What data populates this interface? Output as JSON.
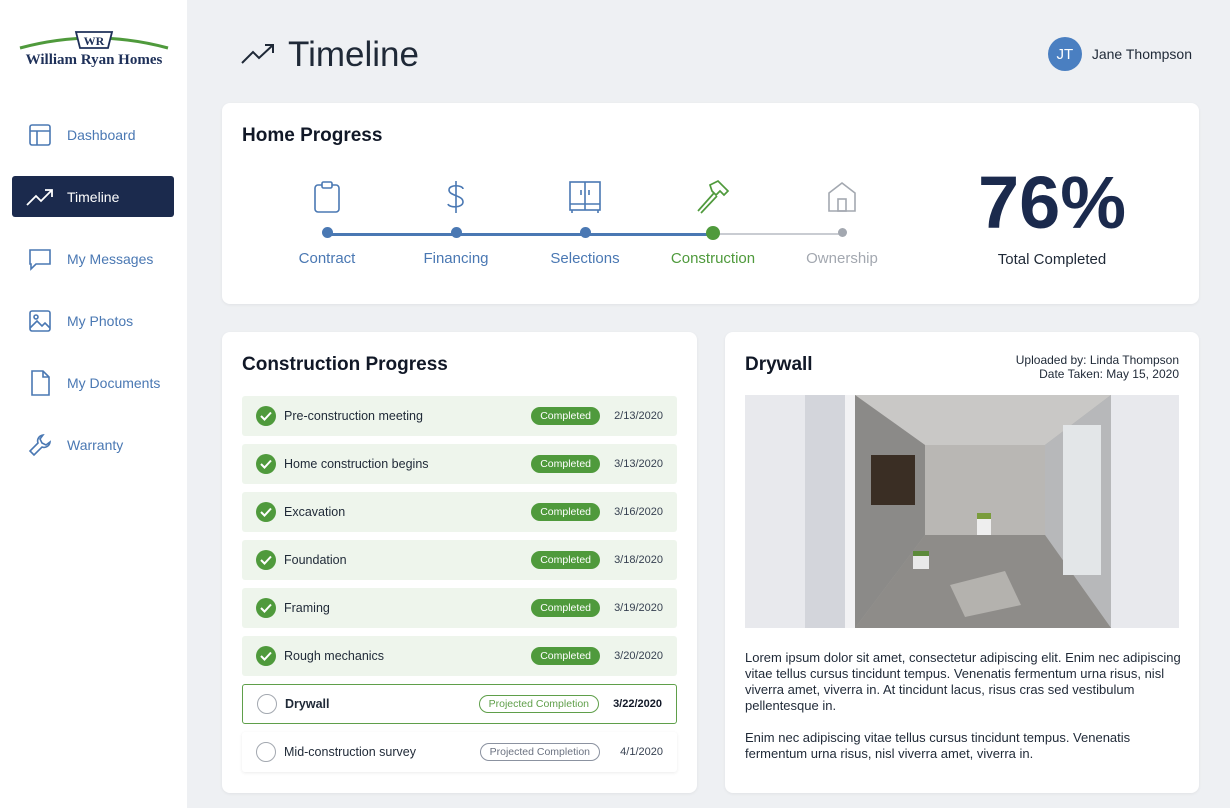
{
  "brand": {
    "monogram": "WR",
    "name": "William Ryan Homes"
  },
  "sidebar": {
    "items": [
      {
        "label": "Dashboard",
        "icon": "dashboard-icon",
        "active": false
      },
      {
        "label": "Timeline",
        "icon": "trending-up-icon",
        "active": true
      },
      {
        "label": "My Messages",
        "icon": "message-icon",
        "active": false
      },
      {
        "label": "My Photos",
        "icon": "image-icon",
        "active": false
      },
      {
        "label": "My Documents",
        "icon": "document-icon",
        "active": false
      },
      {
        "label": "Warranty",
        "icon": "wrench-icon",
        "active": false
      }
    ]
  },
  "header": {
    "title": "Timeline",
    "icon": "trending-up-icon"
  },
  "user": {
    "initials": "JT",
    "name": "Jane Thompson"
  },
  "home_progress": {
    "title": "Home Progress",
    "steps": [
      {
        "label": "Contract",
        "icon": "clipboard-icon",
        "state": "done"
      },
      {
        "label": "Financing",
        "icon": "dollar-icon",
        "state": "done"
      },
      {
        "label": "Selections",
        "icon": "cabinet-icon",
        "state": "done"
      },
      {
        "label": "Construction",
        "icon": "hammer-icon",
        "state": "current"
      },
      {
        "label": "Ownership",
        "icon": "house-icon",
        "state": "future"
      }
    ],
    "percent": "76%",
    "percent_label": "Total Completed"
  },
  "construction_progress": {
    "title": "Construction Progress",
    "tasks": [
      {
        "name": "Pre-construction meeting",
        "status": "Completed",
        "date": "2/13/2020",
        "state": "done"
      },
      {
        "name": "Home construction begins",
        "status": "Completed",
        "date": "3/13/2020",
        "state": "done"
      },
      {
        "name": "Excavation",
        "status": "Completed",
        "date": "3/16/2020",
        "state": "done"
      },
      {
        "name": "Foundation",
        "status": "Completed",
        "date": "3/18/2020",
        "state": "done"
      },
      {
        "name": "Framing",
        "status": "Completed",
        "date": "3/19/2020",
        "state": "done"
      },
      {
        "name": "Rough mechanics",
        "status": "Completed",
        "date": "3/20/2020",
        "state": "done"
      },
      {
        "name": "Drywall",
        "status": "Projected Completion",
        "date": "3/22/2020",
        "state": "current"
      },
      {
        "name": "Mid-construction survey",
        "status": "Projected Completion",
        "date": "4/1/2020",
        "state": "future"
      }
    ]
  },
  "photo_panel": {
    "title": "Drywall",
    "uploaded_by": "Uploaded by: Linda Thompson",
    "date_taken": "Date Taken: May 15, 2020",
    "paragraphs": [
      "Lorem ipsum dolor sit amet, consectetur adipiscing elit. Enim nec adipiscing vitae tellus cursus tincidunt tempus. Venenatis fermentum urna risus, nisl viverra amet, viverra in. At tincidunt lacus, risus cras sed vestibulum pellentesque in.",
      "Enim nec adipiscing vitae tellus cursus tincidunt tempus. Venenatis fermentum urna risus, nisl viverra amet, viverra in."
    ]
  },
  "colors": {
    "navy": "#1b2a4d",
    "blue": "#4a78b3",
    "green": "#4f9a3c",
    "gray": "#a3a8b0"
  }
}
